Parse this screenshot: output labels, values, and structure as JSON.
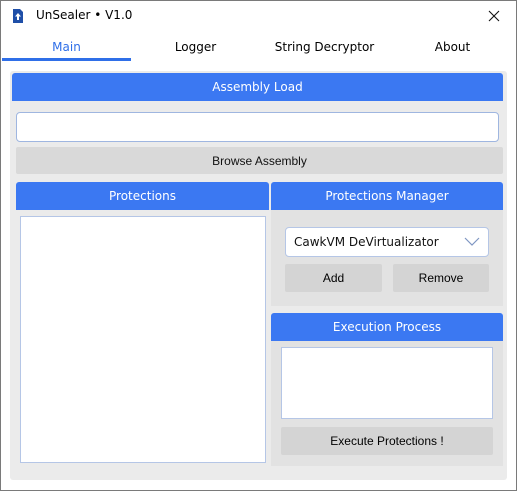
{
  "window": {
    "title": "UnSealer • V1.0",
    "accent_color": "#3b78f2",
    "icons": {
      "app": "app-icon",
      "close": "close-icon"
    }
  },
  "tabs": [
    {
      "label": "Main",
      "active": true
    },
    {
      "label": "Logger",
      "active": false
    },
    {
      "label": "String Decryptor",
      "active": false
    },
    {
      "label": "About",
      "active": false
    }
  ],
  "assembly_load": {
    "header": "Assembly Load",
    "path_value": "",
    "browse_label": "Browse Assembly"
  },
  "protections": {
    "header": "Protections",
    "items": []
  },
  "protections_manager": {
    "header": "Protections Manager",
    "selected": "CawkVM DeVirtualizator",
    "add_label": "Add",
    "remove_label": "Remove"
  },
  "execution_process": {
    "header": "Execution Process",
    "output": "",
    "execute_label": "Execute Protections !"
  }
}
